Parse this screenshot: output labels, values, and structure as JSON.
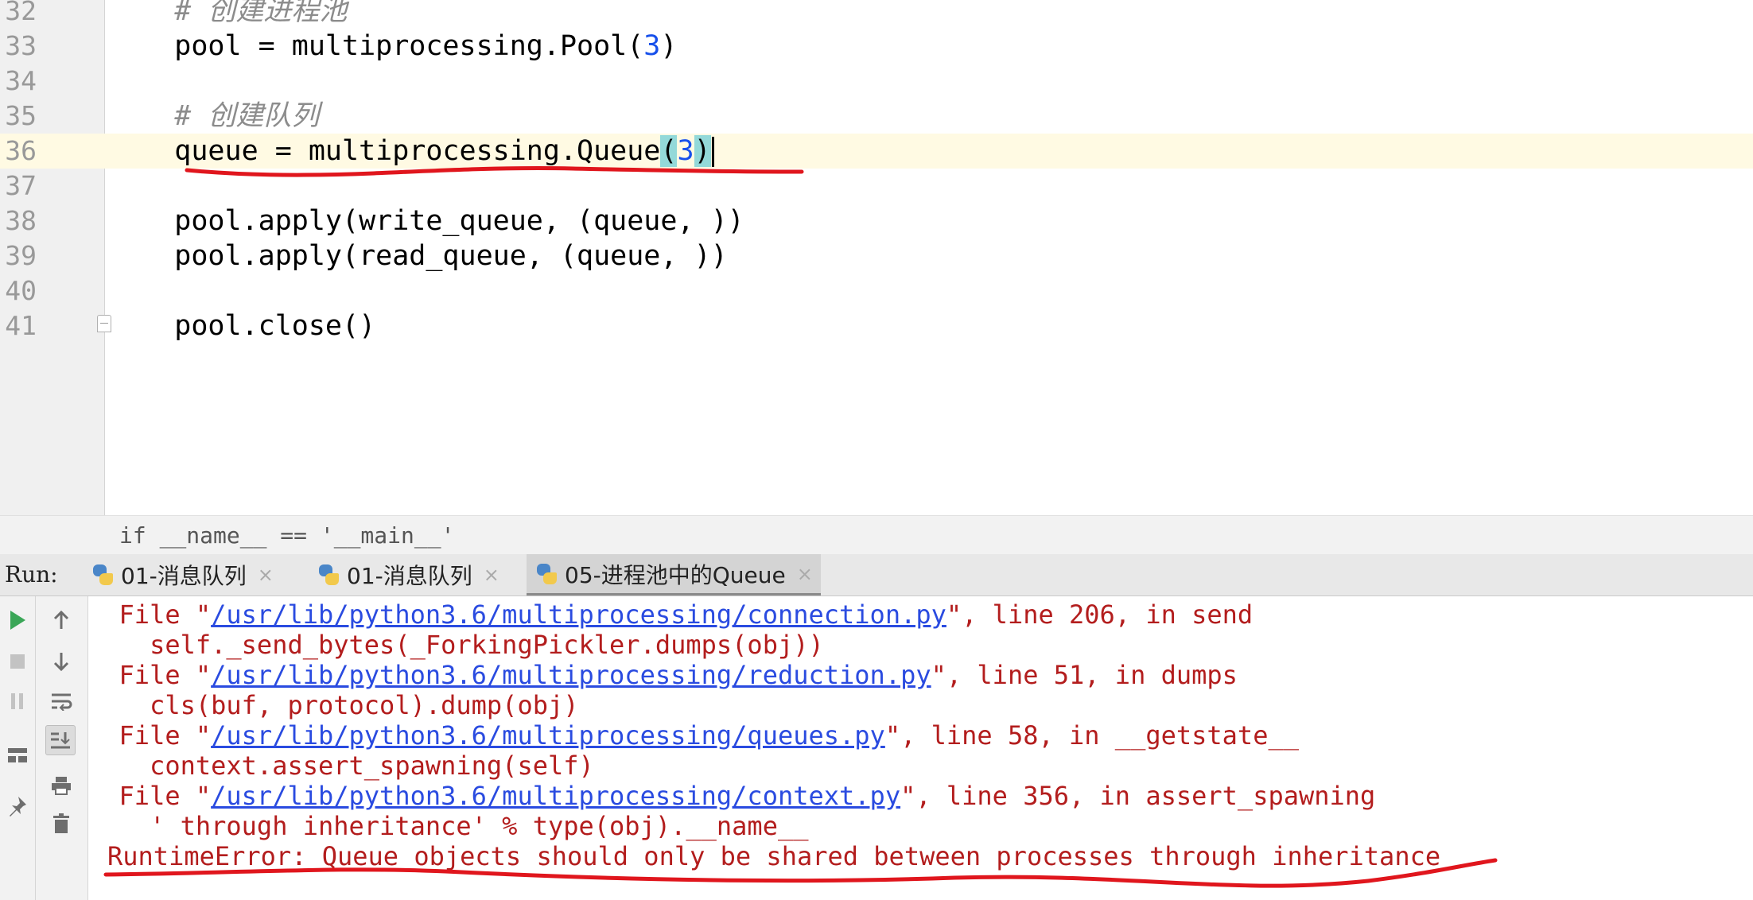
{
  "editor": {
    "lines": [
      {
        "num": "32",
        "segments": [
          {
            "text": "    # 创建进程池",
            "cls": "comment"
          }
        ]
      },
      {
        "num": "33",
        "segments": [
          {
            "text": "    pool = multiprocessing.Pool(",
            "cls": ""
          },
          {
            "text": "3",
            "cls": "num"
          },
          {
            "text": ")",
            "cls": ""
          }
        ]
      },
      {
        "num": "34",
        "segments": []
      },
      {
        "num": "35",
        "segments": [
          {
            "text": "    # 创建队列",
            "cls": "comment"
          }
        ]
      },
      {
        "num": "36",
        "segments": [
          {
            "text": "    queue = multiprocessing.Queue",
            "cls": ""
          },
          {
            "text": "(",
            "cls": "paren-hl"
          },
          {
            "text": "3",
            "cls": "num"
          },
          {
            "text": ")",
            "cls": "paren-hl"
          }
        ],
        "current": true
      },
      {
        "num": "37",
        "segments": []
      },
      {
        "num": "38",
        "segments": [
          {
            "text": "    pool.apply(write_queue, (queue, ))",
            "cls": ""
          }
        ]
      },
      {
        "num": "39",
        "segments": [
          {
            "text": "    pool.apply(read_queue, (queue, ))",
            "cls": ""
          }
        ]
      },
      {
        "num": "40",
        "segments": []
      },
      {
        "num": "41",
        "segments": [
          {
            "text": "    pool.close()",
            "cls": ""
          }
        ]
      }
    ]
  },
  "breadcrumb": "if __name__ == '__main__'",
  "run_panel": {
    "label": "Run:",
    "tabs": [
      {
        "label": "01-消息队列",
        "active": false
      },
      {
        "label": "01-消息队列",
        "active": false
      },
      {
        "label": "05-进程池中的Queue",
        "active": true
      }
    ],
    "tab_close": "×",
    "toolbar_left": [
      "run-icon",
      "stop-icon",
      "pause-icon",
      "layout-icon",
      "pin-icon"
    ],
    "toolbar_right": [
      "up-arrow-icon",
      "down-arrow-icon",
      "soft-wrap-icon",
      "scroll-to-end-icon",
      "print-icon",
      "trash-icon"
    ]
  },
  "console": {
    "lines": [
      {
        "prefix": "  File \"",
        "link": "/usr/lib/python3.6/multiprocessing/connection.py",
        "suffix": "\", line 206, in send"
      },
      {
        "prefix": "    self._send_bytes(_ForkingPickler.dumps(obj))",
        "link": "",
        "suffix": ""
      },
      {
        "prefix": "  File \"",
        "link": "/usr/lib/python3.6/multiprocessing/reduction.py",
        "suffix": "\", line 51, in dumps"
      },
      {
        "prefix": "    cls(buf, protocol).dump(obj)",
        "link": "",
        "suffix": ""
      },
      {
        "prefix": "  File \"",
        "link": "/usr/lib/python3.6/multiprocessing/queues.py",
        "suffix": "\", line 58, in __getstate__"
      },
      {
        "prefix": "    context.assert_spawning(self)",
        "link": "",
        "suffix": ""
      },
      {
        "prefix": "  File \"",
        "link": "/usr/lib/python3.6/multiprocessing/context.py",
        "suffix": "\", line 356, in assert_spawning"
      },
      {
        "prefix": "    ' through inheritance' % type(obj).__name__",
        "link": "",
        "suffix": ""
      },
      {
        "prefix": "RuntimeError: Queue objects should only be shared between processes through inheritance",
        "link": "",
        "suffix": ""
      }
    ]
  },
  "colors": {
    "error_text": "#b31d1d",
    "link": "#2a4be0",
    "annotation": "#e0161d",
    "current_line": "#fffae3"
  }
}
